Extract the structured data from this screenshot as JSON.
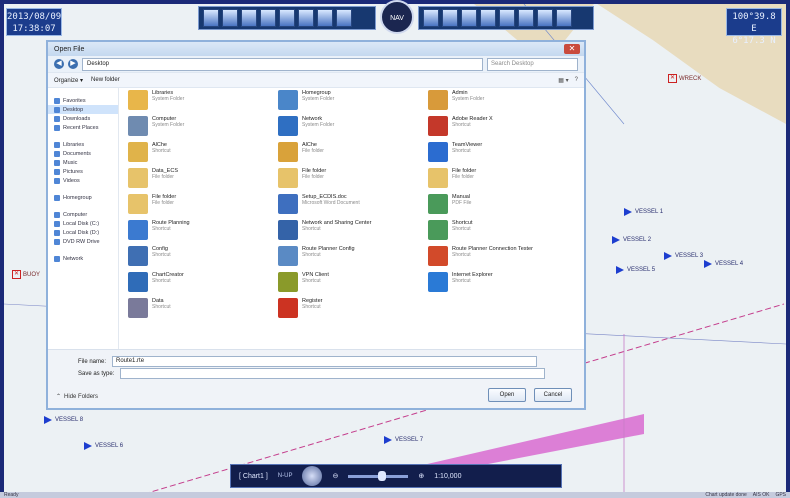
{
  "clock": {
    "date": "2013/08/09",
    "time": "17:38:07"
  },
  "position": {
    "line1": "100°39.8 E",
    "line2": "6°17.3 N"
  },
  "compass_label": "NAV",
  "dialog": {
    "title": "Open File",
    "address": "Desktop",
    "search_placeholder": "Search Desktop",
    "organize": "Organize ▾",
    "new_folder": "New folder",
    "nav_favorites": [
      "Favorites",
      "Desktop",
      "Downloads",
      "Recent Places"
    ],
    "nav_libraries": [
      "Libraries",
      "Documents",
      "Music",
      "Pictures",
      "Videos"
    ],
    "nav_homegroup": "Homegroup",
    "nav_computer": [
      "Computer",
      "Local Disk (C:)",
      "Local Disk (D:)",
      "DVD RW Drive"
    ],
    "nav_network": "Network",
    "files": [
      {
        "name": "Libraries",
        "sub": "System Folder",
        "color": "#e8b64a"
      },
      {
        "name": "Homegroup",
        "sub": "System Folder",
        "color": "#4a86c9"
      },
      {
        "name": "Admin",
        "sub": "System Folder",
        "color": "#d89a3a"
      },
      {
        "name": "Computer",
        "sub": "System Folder",
        "color": "#6f8bb0"
      },
      {
        "name": "Network",
        "sub": "System Folder",
        "color": "#2f6fc2"
      },
      {
        "name": "Adobe Reader X",
        "sub": "Shortcut",
        "color": "#c4382a"
      },
      {
        "name": "AlChe",
        "sub": "Shortcut",
        "color": "#e0b34a"
      },
      {
        "name": "AlChe",
        "sub": "File folder",
        "color": "#d9a23a"
      },
      {
        "name": "TeamViewer",
        "sub": "Shortcut",
        "color": "#2b6cd0"
      },
      {
        "name": "Data_ECS",
        "sub": "File folder",
        "color": "#e7c36a"
      },
      {
        "name": "File folder",
        "sub": "File folder",
        "color": "#e7c36a"
      },
      {
        "name": "File folder",
        "sub": "File folder",
        "color": "#e7c36a"
      },
      {
        "name": "File folder",
        "sub": "File folder",
        "color": "#e7c36a"
      },
      {
        "name": "Setup_ECDIS.doc",
        "sub": "Microsoft Word Document",
        "color": "#3e6fbf"
      },
      {
        "name": "Manual",
        "sub": "PDF File",
        "color": "#4a9a5a"
      },
      {
        "name": "Route Planning",
        "sub": "Shortcut",
        "color": "#3b7ad0"
      },
      {
        "name": "Network and Sharing Center",
        "sub": "Shortcut",
        "color": "#3463a8"
      },
      {
        "name": "Shortcut",
        "sub": "Shortcut",
        "color": "#4a9a5a"
      },
      {
        "name": "Config",
        "sub": "Shortcut",
        "color": "#3f6fb3"
      },
      {
        "name": "Route Planner Config",
        "sub": "Shortcut",
        "color": "#5a8ac4"
      },
      {
        "name": "Route Planner Connection Tester",
        "sub": "Shortcut",
        "color": "#d24a2a"
      },
      {
        "name": "ChartCreator",
        "sub": "Shortcut",
        "color": "#2f6cb8"
      },
      {
        "name": "VPN Client",
        "sub": "Shortcut",
        "color": "#8a9a2a"
      },
      {
        "name": "Internet Explorer",
        "sub": "Shortcut",
        "color": "#2a7ad6"
      },
      {
        "name": "Data",
        "sub": "Shortcut",
        "color": "#7a7a9a"
      },
      {
        "name": "Register",
        "sub": "Shortcut",
        "color": "#cc3322"
      }
    ],
    "file_name_label": "File name:",
    "file_name_value": "Route1.rte",
    "save_type_label": "Save as type:",
    "hide_folders": "Hide Folders",
    "open_button": "Open",
    "cancel_button": "Cancel"
  },
  "vessels": [
    {
      "label": "VESSEL 1"
    },
    {
      "label": "VESSEL 2"
    },
    {
      "label": "VESSEL 3"
    },
    {
      "label": "VESSEL 4"
    },
    {
      "label": "VESSEL 5"
    },
    {
      "label": "VESSEL 6"
    },
    {
      "label": "VESSEL 7"
    },
    {
      "label": "VESSEL 8"
    }
  ],
  "flags": [
    {
      "label": "WRECK"
    },
    {
      "label": "BUOY"
    }
  ],
  "navbar": {
    "chart": "[ Chart1 ]",
    "mode": "N-UP",
    "scale": "1:10,000"
  },
  "status": {
    "left": "Ready",
    "right1": "Chart update done",
    "right2": "AIS OK",
    "right3": "GPS"
  },
  "colors": {
    "frame": "#1b2a78",
    "sea": "#ecf1f4",
    "route": "#d96bd0",
    "vessel": "#1d3ecf"
  }
}
